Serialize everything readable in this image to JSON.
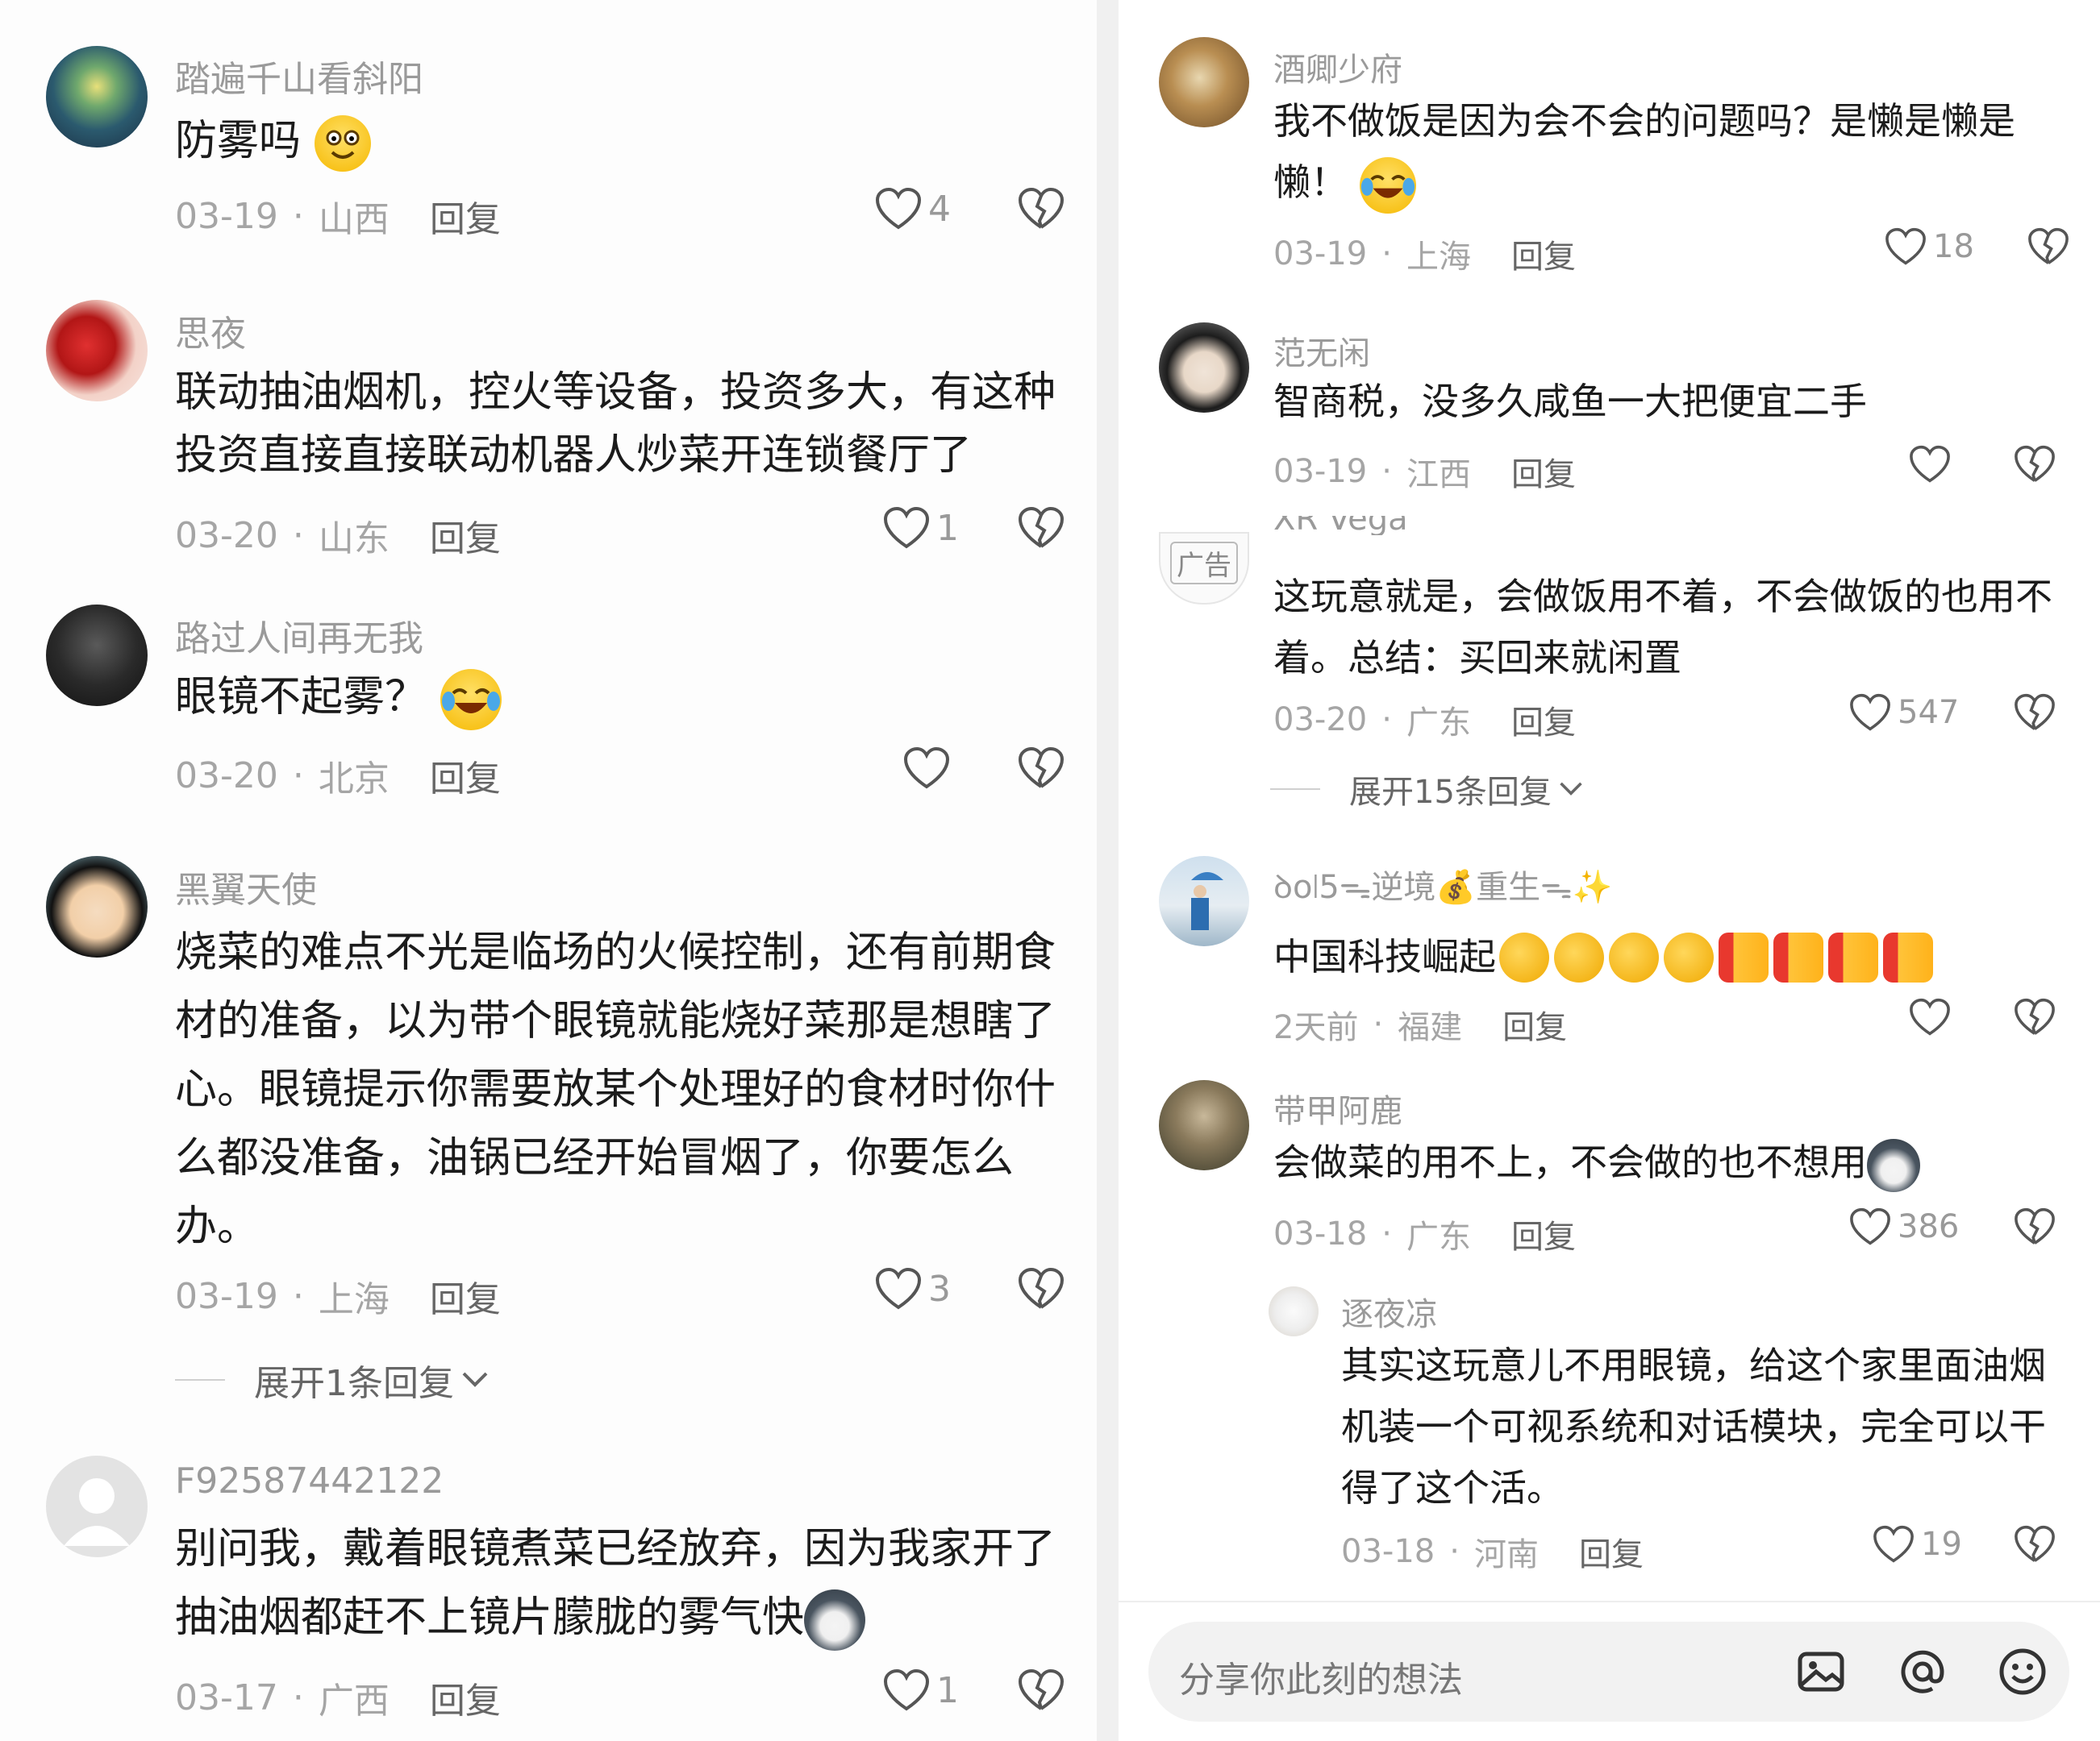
{
  "comments_left": [
    {
      "username": "踏遍千山看斜阳",
      "content": "防雾吗",
      "emoji": "grinning-face",
      "date": "03-19",
      "location": "山西",
      "reply": "回复",
      "likes": "4"
    },
    {
      "username": "思夜",
      "content_lines": [
        "联动抽油烟机，控火等设备，投资多大，有这种",
        "投资直接直接联动机器人炒菜开连锁餐厅了"
      ],
      "date": "03-20",
      "location": "山东",
      "reply": "回复",
      "likes": "1"
    },
    {
      "username": "路过人间再无我",
      "content": "眼镜不起雾？",
      "emoji": "laughing-crying-face",
      "date": "03-20",
      "location": "北京",
      "reply": "回复",
      "likes": ""
    },
    {
      "username": "黑翼天使",
      "content_lines": [
        "烧菜的难点不光是临场的火候控制，还有前期食",
        "材的准备，以为带个眼镜就能烧好菜那是想瞎了",
        "心。眼镜提示你需要放某个处理好的食材时你什",
        "么都没准备，油锅已经开始冒烟了，你要怎么",
        "办。"
      ],
      "date": "03-19",
      "location": "上海",
      "reply": "回复",
      "likes": "3",
      "expand": "展开1条回复"
    },
    {
      "username": "F92587442122",
      "content_lines": [
        "别问我，戴着眼镜煮菜已经放弃，因为我家开了",
        "抽油烟都赶不上镜片朦胧的雾气快"
      ],
      "emoji": "husky-face",
      "date": "03-17",
      "location": "广西",
      "reply": "回复",
      "likes": "1"
    }
  ],
  "comments_right": [
    {
      "username": "酒卿少府",
      "content_lines": [
        "我不做饭是因为会不会的问题吗？是懒是懒是",
        "懒！"
      ],
      "emoji": "laughing-crying-face",
      "date": "03-19",
      "location": "上海",
      "reply": "回复",
      "likes": "18"
    },
    {
      "username": "范无闲",
      "content": "智商税，没多久咸鱼一大把便宜二手",
      "date": "03-19",
      "location": "江西",
      "reply": "回复",
      "likes": ""
    },
    {
      "username": "XR Vega",
      "ad_badge": "广告",
      "content_lines": [
        "这玩意就是，会做饭用不着，不会做饭的也用不",
        "着。总结：买回来就闲置"
      ],
      "date": "03-20",
      "location": "广东",
      "reply": "回复",
      "likes": "547",
      "expand": "展开15条回复"
    },
    {
      "username": "ꝺo꘡5ᯓ逆境💰重生ᯓ✨",
      "content": "中国科技崛起",
      "emojis": [
        "strong",
        "strong",
        "strong",
        "strong",
        "thumbs-up",
        "thumbs-up",
        "thumbs-up",
        "thumbs-up"
      ],
      "date": "2天前",
      "location": "福建",
      "reply": "回复",
      "likes": ""
    },
    {
      "username": "带甲阿鹿",
      "content": "会做菜的用不上，不会做的也不想用",
      "emoji": "husky-face",
      "date": "03-18",
      "location": "广东",
      "reply": "回复",
      "likes": "386"
    },
    {
      "username": "逐夜凉",
      "content_lines": [
        "其实这玩意儿不用眼镜，给这个家里面油烟",
        "机装一个可视系统和对话模块，完全可以干",
        "得了这个活。"
      ],
      "date": "03-18",
      "location": "河南",
      "reply": "回复",
      "likes": "19"
    }
  ],
  "input": {
    "placeholder": "分享你此刻的想法"
  },
  "colors": {
    "accent": "#f5c230",
    "text": "#1b1b1b",
    "meta": "#a5a5a5",
    "username": "#9a9a9a"
  }
}
